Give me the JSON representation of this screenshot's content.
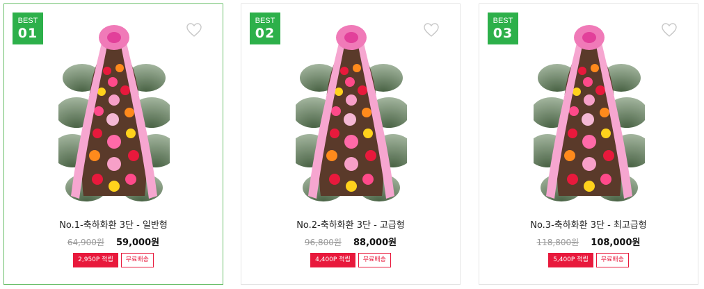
{
  "products": [
    {
      "badge_label": "BEST",
      "rank": "01",
      "title": "No.1-축하화환 3단 - 일반형",
      "old_price": "64,900원",
      "new_price": "59,000원",
      "point_tag": "2,950P 적립",
      "shipping_tag": "무료배송",
      "wishlist_icon": "heart-outline-icon"
    },
    {
      "badge_label": "BEST",
      "rank": "02",
      "title": "No.2-축하화환 3단 - 고급형",
      "old_price": "96,800원",
      "new_price": "88,000원",
      "point_tag": "4,400P 적립",
      "shipping_tag": "무료배송",
      "wishlist_icon": "heart-outline-icon"
    },
    {
      "badge_label": "BEST",
      "rank": "03",
      "title": "No.3-축하화환 3단 - 최고급형",
      "old_price": "118,800원",
      "new_price": "108,000원",
      "point_tag": "5,400P 적립",
      "shipping_tag": "무료배송",
      "wishlist_icon": "heart-outline-icon"
    }
  ],
  "colors": {
    "badge": "#2db04a",
    "point_tag": "#e8193c",
    "active_border": "#6bbf6b"
  }
}
